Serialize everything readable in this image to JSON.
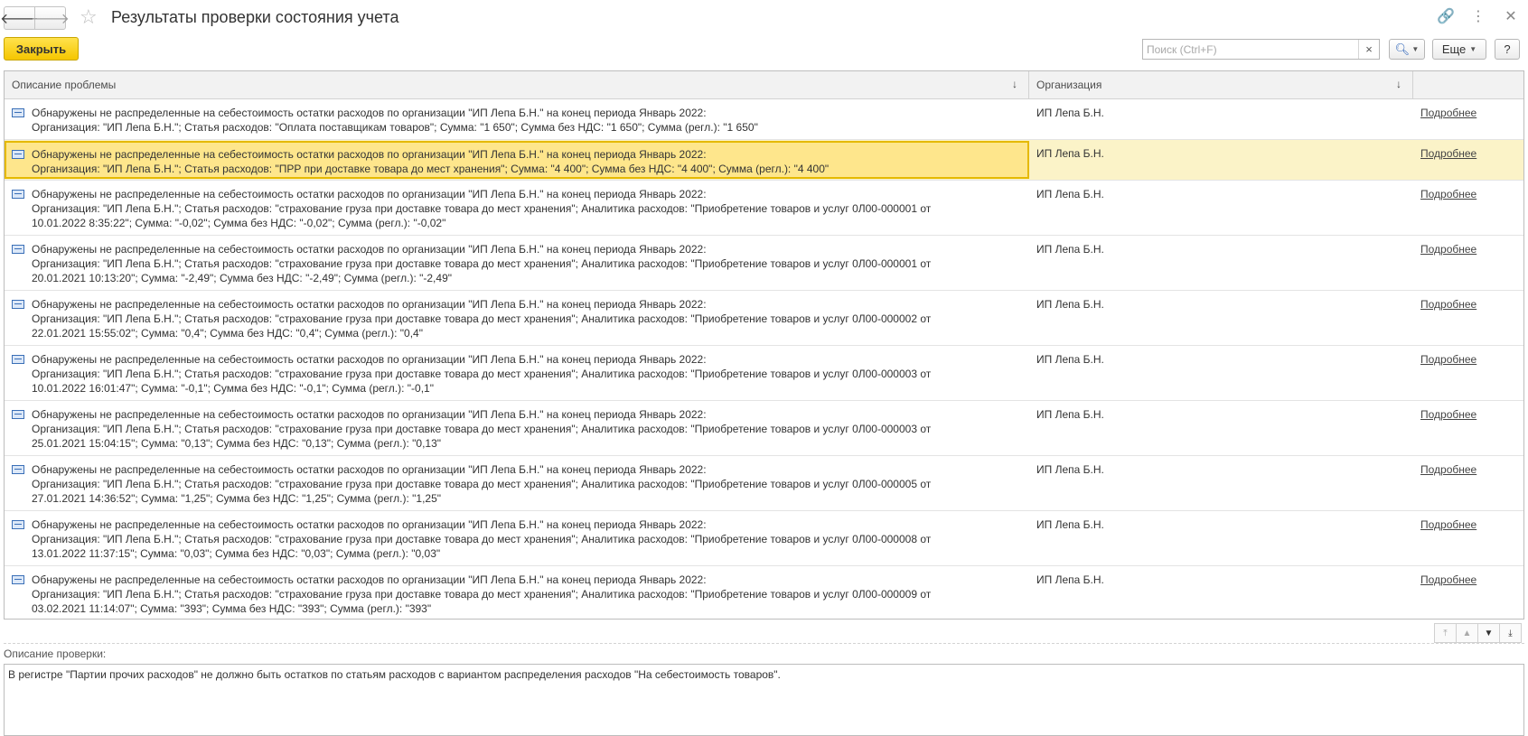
{
  "window": {
    "title": "Результаты проверки состояния учета"
  },
  "toolbar": {
    "close_label": "Закрыть",
    "search_placeholder": "Поиск (Ctrl+F)",
    "search_clear": "×",
    "more_label": "Еще",
    "help_label": "?"
  },
  "table": {
    "headers": {
      "description": "Описание проблемы",
      "organization": "Организация"
    },
    "rows": [
      {
        "description": "Обнаружены не распределенные на себестоимость остатки расходов по организации \"ИП Лепа Б.Н.\" на конец периода Январь 2022:\nОрганизация: \"ИП Лепа Б.Н.\"; Статья расходов: \"Оплата поставщикам товаров\"; Сумма: \"1 650\"; Сумма без НДС: \"1 650\"; Сумма (регл.): \"1 650\"",
        "organization": "ИП Лепа Б.Н.",
        "link": "Подробнее"
      },
      {
        "description": "Обнаружены не распределенные на себестоимость остатки расходов по организации \"ИП Лепа Б.Н.\" на конец периода Январь 2022:\nОрганизация: \"ИП Лепа Б.Н.\"; Статья расходов: \"ПРР при доставке товара до мест хранения\"; Сумма: \"4 400\"; Сумма без НДС: \"4 400\"; Сумма (регл.): \"4 400\"",
        "organization": "ИП Лепа Б.Н.",
        "link": "Подробнее"
      },
      {
        "description": "Обнаружены не распределенные на себестоимость остатки расходов по организации \"ИП Лепа Б.Н.\" на конец периода Январь 2022:\nОрганизация: \"ИП Лепа Б.Н.\"; Статья расходов: \"страхование груза при доставке товара до мест хранения\"; Аналитика расходов: \"Приобретение товаров и услуг 0Л00-000001 от\n10.01.2022 8:35:22\"; Сумма: \"-0,02\"; Сумма без НДС: \"-0,02\"; Сумма (регл.): \"-0,02\"",
        "organization": "ИП Лепа Б.Н.",
        "link": "Подробнее"
      },
      {
        "description": "Обнаружены не распределенные на себестоимость остатки расходов по организации \"ИП Лепа Б.Н.\" на конец периода Январь 2022:\nОрганизация: \"ИП Лепа Б.Н.\"; Статья расходов: \"страхование груза при доставке товара до мест хранения\"; Аналитика расходов: \"Приобретение товаров и услуг 0Л00-000001 от\n20.01.2021 10:13:20\"; Сумма: \"-2,49\"; Сумма без НДС: \"-2,49\"; Сумма (регл.): \"-2,49\"",
        "organization": "ИП Лепа Б.Н.",
        "link": "Подробнее"
      },
      {
        "description": "Обнаружены не распределенные на себестоимость остатки расходов по организации \"ИП Лепа Б.Н.\" на конец периода Январь 2022:\nОрганизация: \"ИП Лепа Б.Н.\"; Статья расходов: \"страхование груза при доставке товара до мест хранения\"; Аналитика расходов: \"Приобретение товаров и услуг 0Л00-000002 от\n22.01.2021 15:55:02\"; Сумма: \"0,4\"; Сумма без НДС: \"0,4\"; Сумма (регл.): \"0,4\"",
        "organization": "ИП Лепа Б.Н.",
        "link": "Подробнее"
      },
      {
        "description": "Обнаружены не распределенные на себестоимость остатки расходов по организации \"ИП Лепа Б.Н.\" на конец периода Январь 2022:\nОрганизация: \"ИП Лепа Б.Н.\"; Статья расходов: \"страхование груза при доставке товара до мест хранения\"; Аналитика расходов: \"Приобретение товаров и услуг 0Л00-000003 от\n10.01.2022 16:01:47\"; Сумма: \"-0,1\"; Сумма без НДС: \"-0,1\"; Сумма (регл.): \"-0,1\"",
        "organization": "ИП Лепа Б.Н.",
        "link": "Подробнее"
      },
      {
        "description": "Обнаружены не распределенные на себестоимость остатки расходов по организации \"ИП Лепа Б.Н.\" на конец периода Январь 2022:\nОрганизация: \"ИП Лепа Б.Н.\"; Статья расходов: \"страхование груза при доставке товара до мест хранения\"; Аналитика расходов: \"Приобретение товаров и услуг 0Л00-000003 от\n25.01.2021 15:04:15\"; Сумма: \"0,13\"; Сумма без НДС: \"0,13\"; Сумма (регл.): \"0,13\"",
        "organization": "ИП Лепа Б.Н.",
        "link": "Подробнее"
      },
      {
        "description": "Обнаружены не распределенные на себестоимость остатки расходов по организации \"ИП Лепа Б.Н.\" на конец периода Январь 2022:\nОрганизация: \"ИП Лепа Б.Н.\"; Статья расходов: \"страхование груза при доставке товара до мест хранения\"; Аналитика расходов: \"Приобретение товаров и услуг 0Л00-000005 от\n27.01.2021 14:36:52\"; Сумма: \"1,25\"; Сумма без НДС: \"1,25\"; Сумма (регл.): \"1,25\"",
        "organization": "ИП Лепа Б.Н.",
        "link": "Подробнее"
      },
      {
        "description": "Обнаружены не распределенные на себестоимость остатки расходов по организации \"ИП Лепа Б.Н.\" на конец периода Январь 2022:\nОрганизация: \"ИП Лепа Б.Н.\"; Статья расходов: \"страхование груза при доставке товара до мест хранения\"; Аналитика расходов: \"Приобретение товаров и услуг 0Л00-000008 от\n13.01.2022 11:37:15\"; Сумма: \"0,03\"; Сумма без НДС: \"0,03\"; Сумма (регл.): \"0,03\"",
        "organization": "ИП Лепа Б.Н.",
        "link": "Подробнее"
      },
      {
        "description": "Обнаружены не распределенные на себестоимость остатки расходов по организации \"ИП Лепа Б.Н.\" на конец периода Январь 2022:\nОрганизация: \"ИП Лепа Б.Н.\"; Статья расходов: \"страхование груза при доставке товара до мест хранения\"; Аналитика расходов: \"Приобретение товаров и услуг 0Л00-000009 от\n03.02.2021 11:14:07\"; Сумма: \"393\"; Сумма без НДС: \"393\"; Сумма (регл.): \"393\"",
        "organization": "ИП Лепа Б.Н.",
        "link": "Подробнее"
      }
    ],
    "selected_row": 1
  },
  "check": {
    "label": "Описание проверки:",
    "text": "В регистре \"Партии прочих расходов\" не должно быть остатков по статьям расходов с вариантом распределения расходов \"На себестоимость товаров\"."
  },
  "icons": {
    "back": "arrow-left-icon",
    "forward": "arrow-right-icon",
    "favorite": "star-icon",
    "link": "link-icon",
    "menu": "more-vertical-icon",
    "close": "close-icon",
    "search": "magnifier-icon",
    "row": "message-icon"
  },
  "colors": {
    "primary_button": "#f5c600",
    "selected_row": "#fee68c",
    "selected_border": "#e5b900"
  }
}
